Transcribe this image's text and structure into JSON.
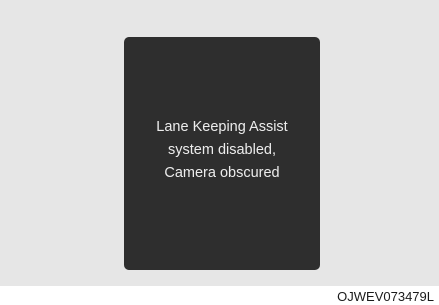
{
  "display": {
    "message_lines": [
      "Lane Keeping Assist",
      "system disabled,",
      "Camera obscured"
    ]
  },
  "figure_code": "OJWEV073479L",
  "colors": {
    "background": "#e6e6e6",
    "display_panel": "#2e2e2e",
    "message_text": "#ececec"
  }
}
